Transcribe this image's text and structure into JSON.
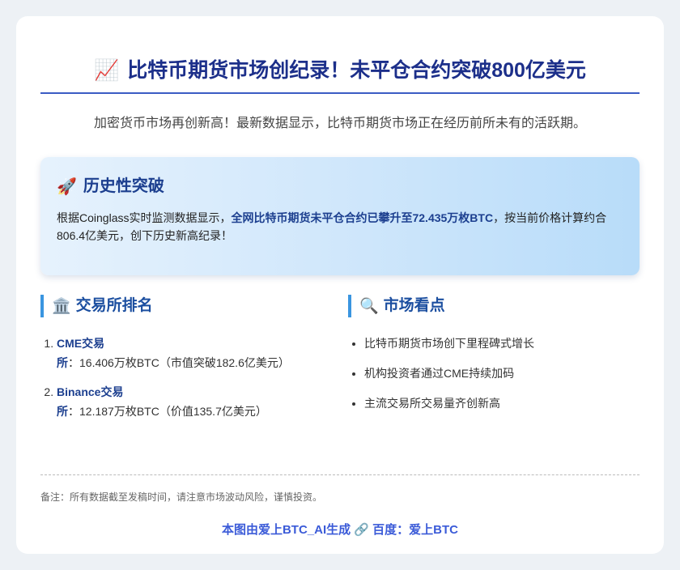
{
  "header": {
    "icon": "chart-increasing-emoji",
    "icon_glyph": "📈",
    "title": "比特币期货市场创纪录！未平仓合约突破800亿美元"
  },
  "intro": "加密货币市场再创新高！最新数据显示，比特币期货市场正在经历前所未有的活跃期。",
  "highlight": {
    "icon": "rocket-emoji",
    "icon_glyph": "🚀",
    "title": "历史性突破",
    "text_pre": "根据Coinglass实时监测数据显示，",
    "text_bold": "全网比特币期货未平仓合约已攀升至72.435万枚BTC",
    "text_post": "，按当前价格计算约合806.4亿美元，创下历史新高纪录！"
  },
  "ranking": {
    "icon": "bank-emoji",
    "icon_glyph": "🏛️",
    "title": "交易所排名",
    "items": [
      {
        "name": "CME交易所",
        "detail": "：16.406万枚BTC（市值突破182.6亿美元）"
      },
      {
        "name": "Binance交易所",
        "detail": "：12.187万枚BTC（价值135.7亿美元）"
      }
    ]
  },
  "points": {
    "icon": "magnifier-emoji",
    "icon_glyph": "🔍",
    "title": "市场看点",
    "items": [
      "比特币期货市场创下里程碑式增长",
      "机构投资者通过CME持续加码",
      "主流交易所交易量齐创新高"
    ]
  },
  "note": "备注：所有数据截至发稿时间，请注意市场波动风险，谨慎投资。",
  "footer": {
    "left": "本图由爱上BTC_AI生成",
    "icon": "link-emoji",
    "icon_glyph": "🔗",
    "right": "百度：爱上BTC"
  }
}
